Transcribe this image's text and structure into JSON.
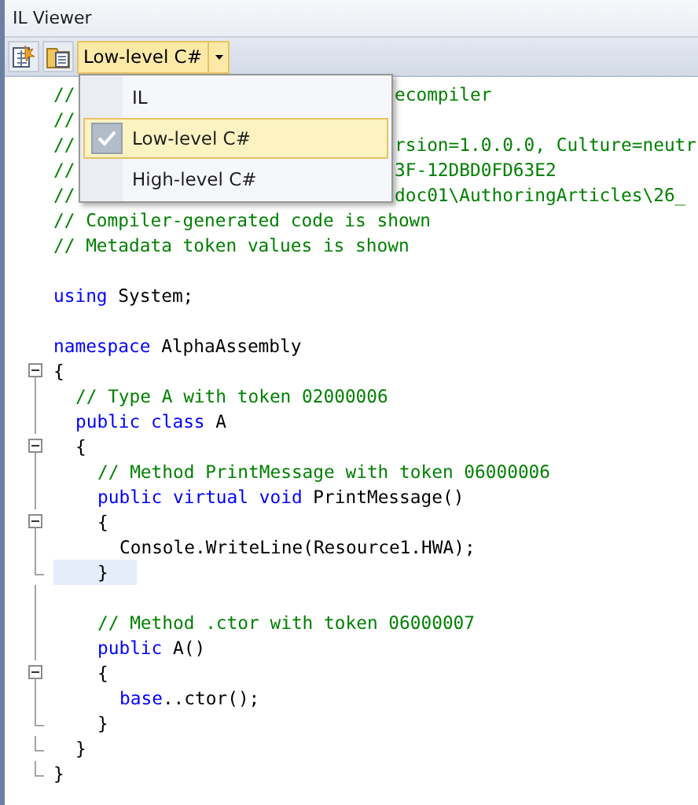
{
  "window": {
    "title": "IL Viewer"
  },
  "toolbar": {
    "dropdown": {
      "value": "Low-level C#",
      "open": true
    }
  },
  "menu": {
    "items": [
      {
        "label": "IL",
        "selected": false
      },
      {
        "label": "Low-level C#",
        "selected": true
      },
      {
        "label": "High-level C#",
        "selected": false
      }
    ]
  },
  "code": {
    "lines": [
      {
        "kind": "covered",
        "start": "//",
        "end": "ecompiler"
      },
      {
        "kind": "covered",
        "start": "//"
      },
      {
        "kind": "covered",
        "start": "//",
        "end": "rsion=1.0.0.0, Culture=neutr"
      },
      {
        "kind": "covered",
        "start": "//",
        "end": "3F-12DBD0FD63E2"
      },
      {
        "kind": "covered",
        "start": "//",
        "end": "doc01\\AuthoringArticles\\26_"
      },
      {
        "kind": "line",
        "segments": [
          {
            "kind": "comment",
            "text": "// Compiler-generated code is shown"
          }
        ]
      },
      {
        "kind": "line",
        "segments": [
          {
            "kind": "comment",
            "text": "// Metadata token values is shown"
          }
        ]
      },
      {
        "kind": "line",
        "spaced": true,
        "segments": [
          {
            "kind": "keyword",
            "text": "using"
          },
          {
            "kind": "plain",
            "text": " System;"
          }
        ]
      },
      {
        "kind": "line",
        "spaced": true,
        "segments": [
          {
            "kind": "keyword",
            "text": "namespace"
          },
          {
            "kind": "plain",
            "text": " AlphaAssembly"
          }
        ]
      },
      {
        "kind": "block",
        "expanded": true,
        "open": "{",
        "close": "}",
        "children": [
          {
            "kind": "line",
            "segments": [
              {
                "kind": "comment",
                "text": "// Type A with token 02000006"
              }
            ]
          },
          {
            "kind": "line",
            "segments": [
              {
                "kind": "keyword",
                "text": "public class"
              },
              {
                "kind": "plain",
                "text": " A"
              }
            ]
          },
          {
            "kind": "block",
            "expanded": true,
            "open": "{",
            "close": "}",
            "children": [
              {
                "kind": "line",
                "segments": [
                  {
                    "kind": "comment",
                    "text": "// Method PrintMessage with token 06000006"
                  }
                ]
              },
              {
                "kind": "line",
                "segments": [
                  {
                    "kind": "keyword",
                    "text": "public virtual void"
                  },
                  {
                    "kind": "plain",
                    "text": " PrintMessage()"
                  }
                ]
              },
              {
                "kind": "block",
                "expanded": true,
                "open": "{",
                "close": "}",
                "close_highlighted": true,
                "children": [
                  {
                    "kind": "line",
                    "segments": [
                      {
                        "kind": "plain",
                        "text": "Console.WriteLine(Resource1.HWA);"
                      }
                    ]
                  }
                ]
              },
              {
                "kind": "line",
                "spaced": true,
                "segments": [
                  {
                    "kind": "comment",
                    "text": "// Method .ctor with token 06000007"
                  }
                ]
              },
              {
                "kind": "line",
                "segments": [
                  {
                    "kind": "keyword",
                    "text": "public"
                  },
                  {
                    "kind": "plain",
                    "text": " A()"
                  }
                ]
              },
              {
                "kind": "block",
                "expanded": true,
                "open": "{",
                "close": "}",
                "children": [
                  {
                    "kind": "line",
                    "segments": [
                      {
                        "kind": "keyword",
                        "text": "base"
                      },
                      {
                        "kind": "plain",
                        "text": "..ctor();"
                      }
                    ]
                  }
                ]
              }
            ]
          }
        ]
      }
    ]
  }
}
